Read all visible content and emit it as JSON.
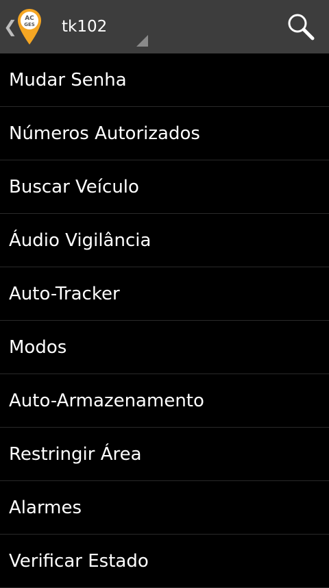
{
  "action_bar": {
    "back_icon": "chevron-left-icon",
    "logo_icon": "map-pin-logo-icon",
    "logo_text": "ACGES",
    "device_selector": {
      "selected": "tk102"
    },
    "search_icon": "search-icon"
  },
  "colors": {
    "action_bar_bg": "#3d3d3d",
    "list_bg": "#000000",
    "divider": "#2a2a2a",
    "logo_accent": "#f5a623",
    "text": "#ffffff"
  },
  "menu": {
    "items": [
      {
        "label": "Mudar Senha"
      },
      {
        "label": "Números Autorizados"
      },
      {
        "label": "Buscar Veículo"
      },
      {
        "label": "Áudio Vigilância"
      },
      {
        "label": "Auto-Tracker"
      },
      {
        "label": "Modos"
      },
      {
        "label": "Auto-Armazenamento"
      },
      {
        "label": "Restringir Área"
      },
      {
        "label": "Alarmes"
      },
      {
        "label": "Verificar Estado"
      }
    ]
  }
}
